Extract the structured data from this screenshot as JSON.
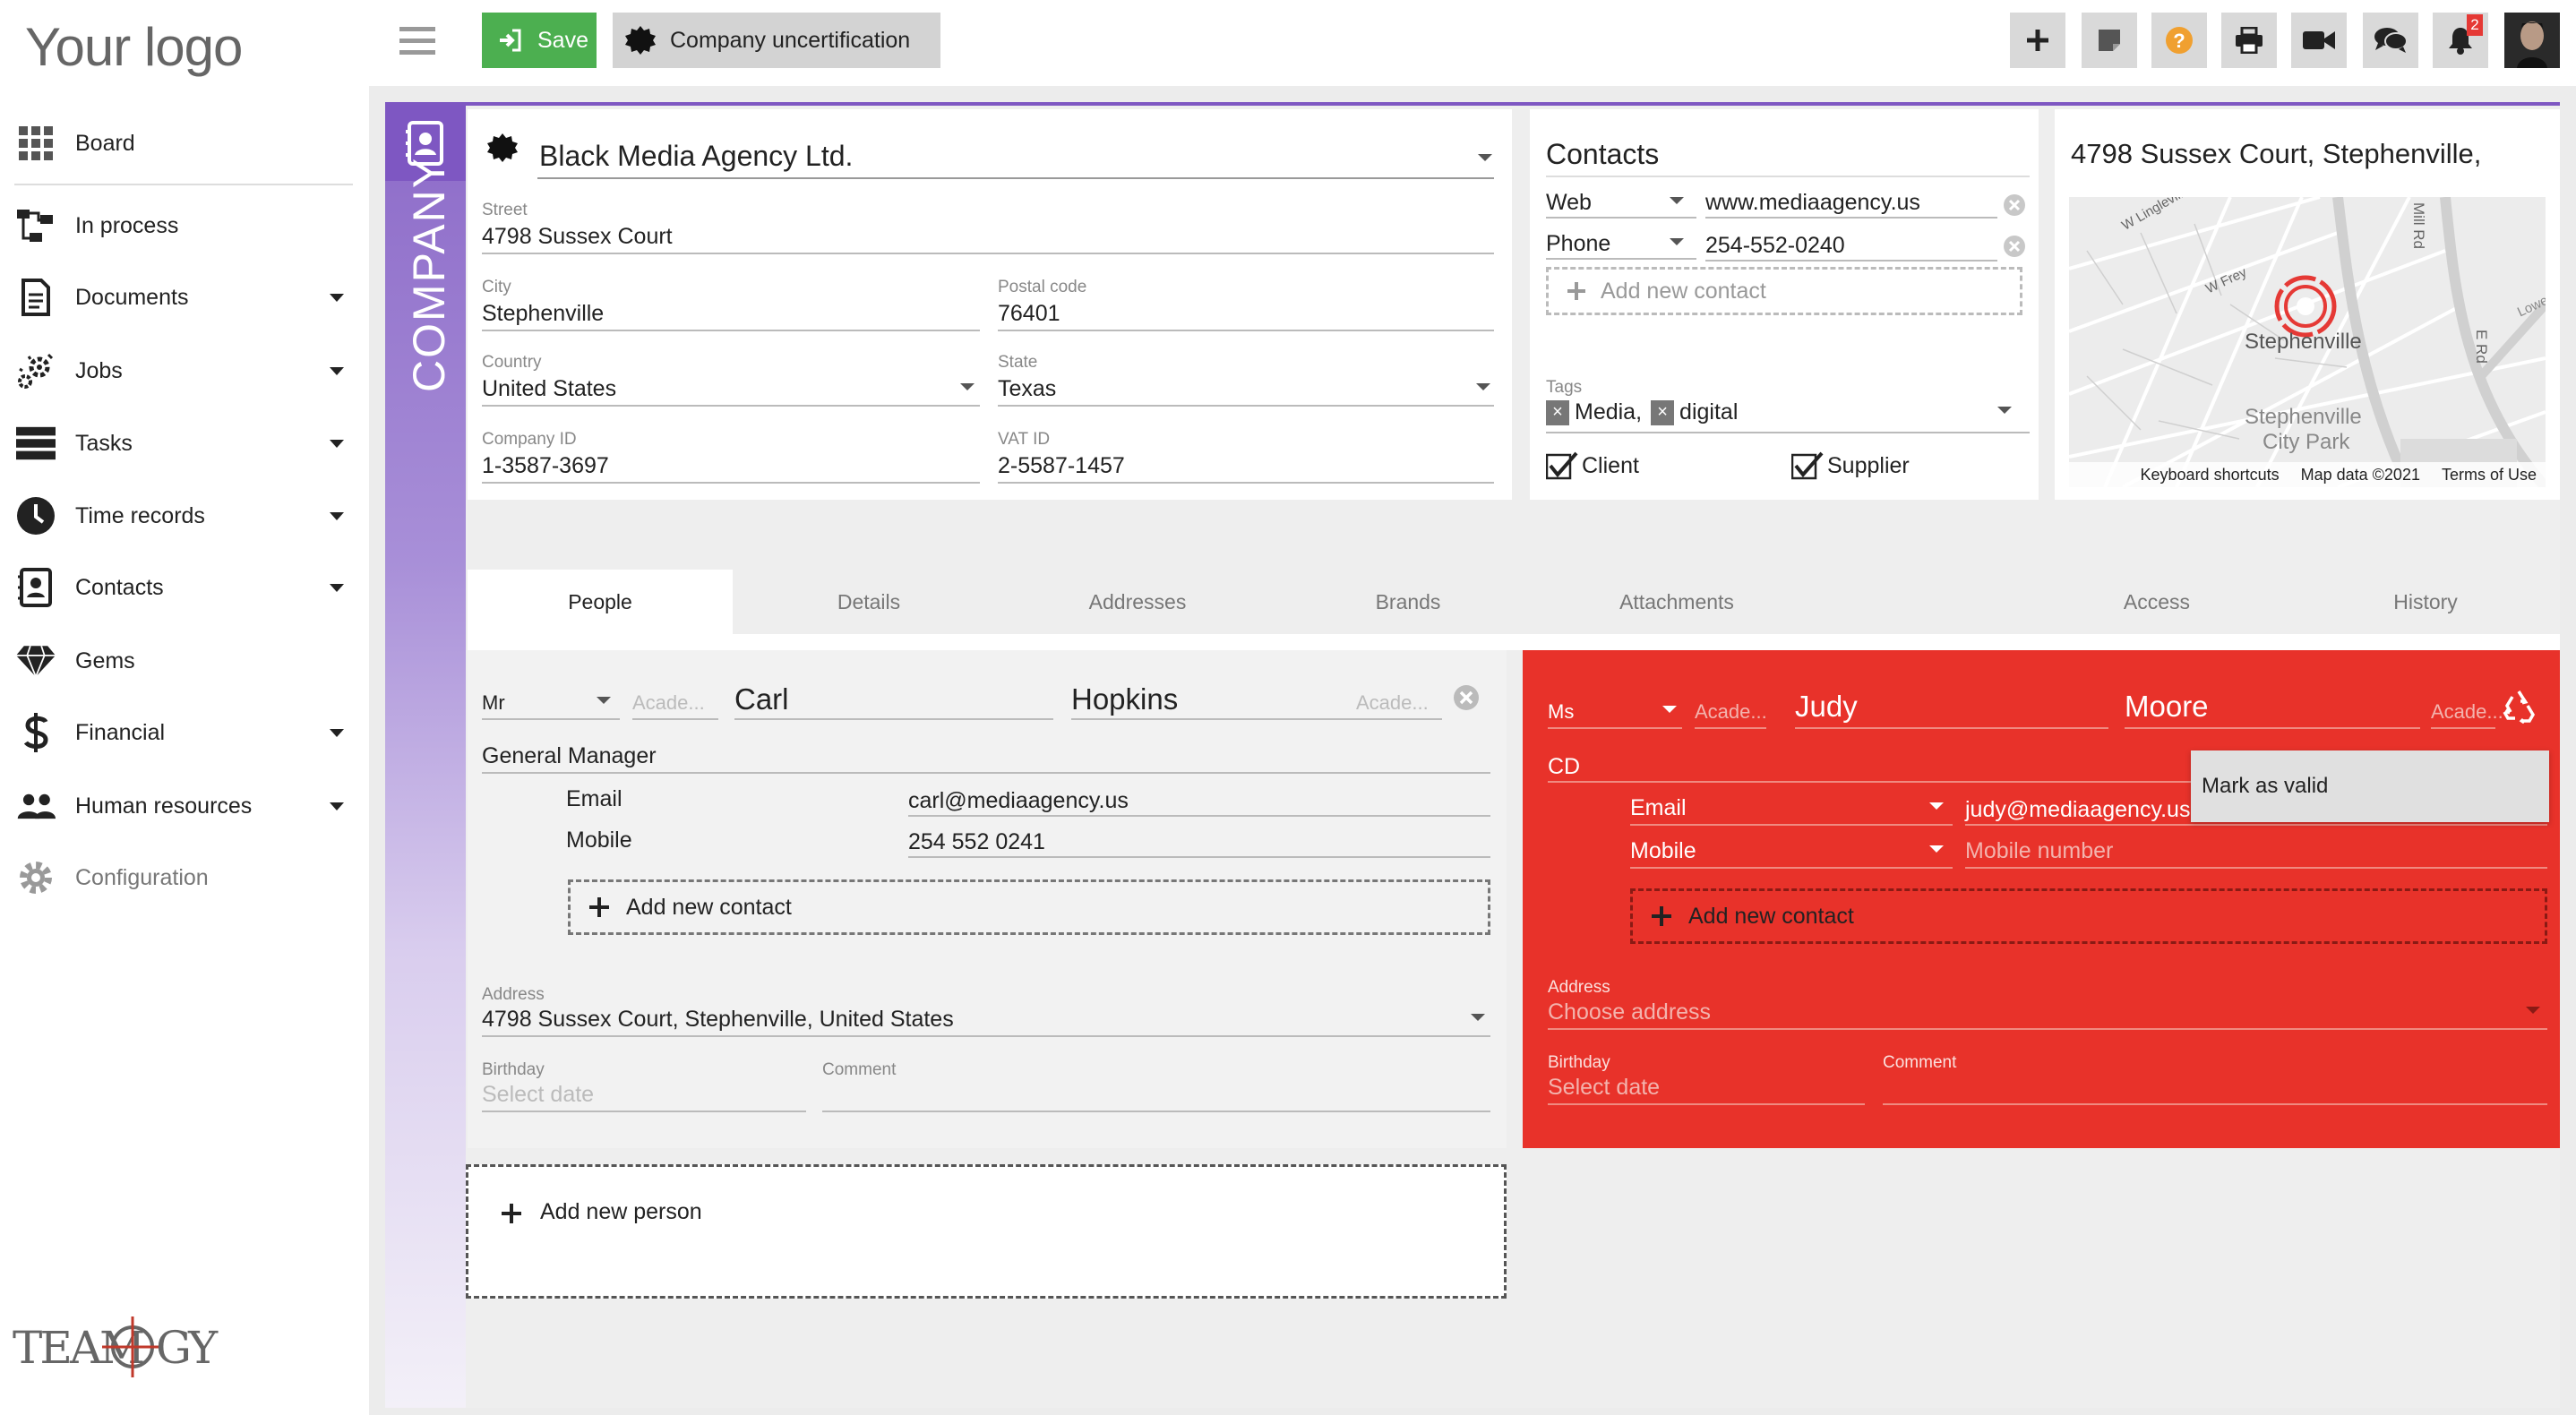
{
  "app": {
    "logo": "Your logo",
    "brand_mark": "TEAMOGY"
  },
  "sidebar": {
    "items": [
      {
        "label": "Board",
        "icon": "grid-icon",
        "has_caret": false
      },
      {
        "label": "In process",
        "icon": "workflow-icon",
        "has_caret": false
      },
      {
        "label": "Documents",
        "icon": "document-icon",
        "has_caret": true
      },
      {
        "label": "Jobs",
        "icon": "jobs-gear-icon",
        "has_caret": true
      },
      {
        "label": "Tasks",
        "icon": "tasks-icon",
        "has_caret": true
      },
      {
        "label": "Time records",
        "icon": "clock-icon",
        "has_caret": true
      },
      {
        "label": "Contacts",
        "icon": "contact-card-icon",
        "has_caret": true
      },
      {
        "label": "Gems",
        "icon": "diamond-icon",
        "has_caret": false
      },
      {
        "label": "Financial",
        "icon": "dollar-icon",
        "has_caret": true
      },
      {
        "label": "Human resources",
        "icon": "people-icon",
        "has_caret": true
      },
      {
        "label": "Configuration",
        "icon": "gear-icon",
        "has_caret": false
      }
    ]
  },
  "toolbar": {
    "save_label": "Save",
    "uncert_label": "Company uncertification",
    "notification_count": "2",
    "accent_save": "#4caf50"
  },
  "company": {
    "vertical_label": "COMPANY",
    "name": "Black Media Agency Ltd.",
    "street_label": "Street",
    "street": "4798  Sussex Court",
    "city_label": "City",
    "city": "Stephenville",
    "postal_label": "Postal code",
    "postal": "76401",
    "country_label": "Country",
    "country": "United States",
    "state_label": "State",
    "state": "Texas",
    "company_id_label": "Company ID",
    "company_id": "1-3587-3697",
    "vat_label": "VAT ID",
    "vat": "2-5587-1457"
  },
  "contacts": {
    "title": "Contacts",
    "rows": [
      {
        "type": "Web",
        "value": "www.mediaagency.us"
      },
      {
        "type": "Phone",
        "value": "254-552-0240"
      }
    ],
    "add_label": "Add new contact",
    "tags_label": "Tags",
    "tags": [
      "Media,",
      "digital"
    ],
    "client_label": "Client",
    "supplier_label": "Supplier"
  },
  "map": {
    "title": "4798 Sussex Court, Stephenville,",
    "labels": [
      "W Lingleville Rd",
      "W Frey",
      "Mill Rd",
      "E Rd",
      "Stephenville",
      "Stephenville",
      "City Park",
      "Lowe"
    ],
    "footer": [
      "Keyboard shortcuts",
      "Map data ©2021",
      "Terms of Use"
    ]
  },
  "tabs": [
    "People",
    "Details",
    "Addresses",
    "Brands",
    "Attachments",
    "Access",
    "History"
  ],
  "person1": {
    "salutation": "Mr",
    "acad_placeholder": "Acade...",
    "first": "Carl",
    "last": "Hopkins",
    "acad_placeholder2": "Acade...",
    "position": "General Manager",
    "contacts": [
      {
        "type": "Email",
        "value": "carl@mediaagency.us"
      },
      {
        "type": "Mobile",
        "value": "254 552 0241"
      }
    ],
    "add_label": "Add new contact",
    "address_label": "Address",
    "address": "4798 Sussex Court, Stephenville, United States",
    "birthday_label": "Birthday",
    "birthday_placeholder": "Select date",
    "comment_label": "Comment"
  },
  "person2": {
    "salutation": "Ms",
    "acad_placeholder": "Acade...",
    "first": "Judy",
    "last": "Moore",
    "acad_placeholder2": "Acade...",
    "position": "CD",
    "contacts": [
      {
        "type": "Email",
        "value": "judy@mediaagency.us"
      },
      {
        "type": "Mobile",
        "value": "Mobile number"
      }
    ],
    "add_label": "Add new contact",
    "address_label": "Address",
    "address_placeholder": "Choose address",
    "birthday_label": "Birthday",
    "birthday_placeholder": "Select date",
    "comment_label": "Comment",
    "tooltip": "Mark as valid",
    "bg_color": "#e8322a"
  },
  "add_person_label": "Add new person"
}
